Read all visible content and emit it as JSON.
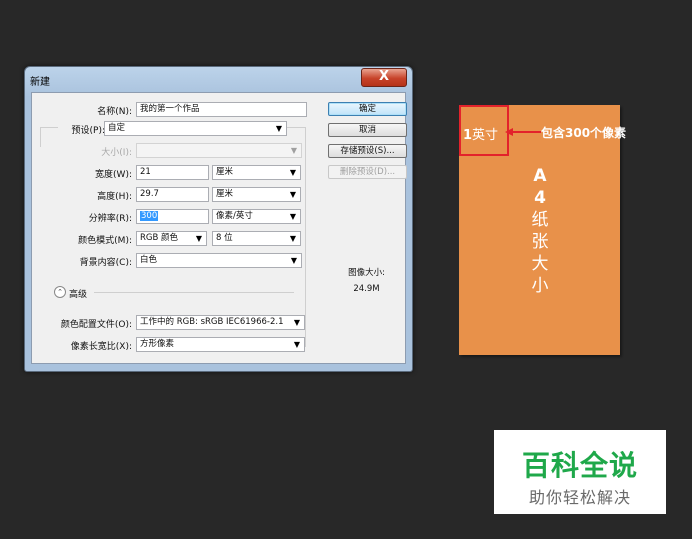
{
  "dialog": {
    "title": "新建",
    "close_label": "X",
    "fields": {
      "name": {
        "label": "名称(N):",
        "value": "我的第一个作品"
      },
      "preset": {
        "label": "预设(P):",
        "value": "自定"
      },
      "size": {
        "label": "大小(I):",
        "value": ""
      },
      "width": {
        "label": "宽度(W):",
        "value": "21",
        "unit": "厘米"
      },
      "height": {
        "label": "高度(H):",
        "value": "29.7",
        "unit": "厘米"
      },
      "resolution": {
        "label": "分辨率(R):",
        "value": "300",
        "unit": "像素/英寸"
      },
      "color_mode": {
        "label": "颜色模式(M):",
        "value": "RGB 颜色",
        "depth": "8 位"
      },
      "background": {
        "label": "背景内容(C):",
        "value": "白色"
      },
      "advanced": {
        "label": "高级"
      },
      "color_profile": {
        "label": "颜色配置文件(O):",
        "value": "工作中的 RGB: sRGB IEC61966-2.1"
      },
      "pixel_aspect": {
        "label": "像素长宽比(X):",
        "value": "方形像素"
      }
    },
    "buttons": {
      "ok": "确定",
      "cancel": "取消",
      "save_preset": "存储预设(S)...",
      "delete_preset": "删除预设(D)..."
    },
    "image_size": {
      "label": "图像大小:",
      "value": "24.9M"
    }
  },
  "illustration": {
    "inch_number": "1",
    "inch_unit": "英寸",
    "annotation": "包含300个像素",
    "paper_label_a": "A",
    "paper_label_4": "4",
    "paper_label_chars": [
      "纸",
      "张",
      "大",
      "小"
    ],
    "paper_color": "#e8914a",
    "highlight_color": "#e3222b"
  },
  "watermark": {
    "title": "百科全说",
    "subtitle": "助你轻松解决",
    "title_color": "#1fa84a"
  }
}
